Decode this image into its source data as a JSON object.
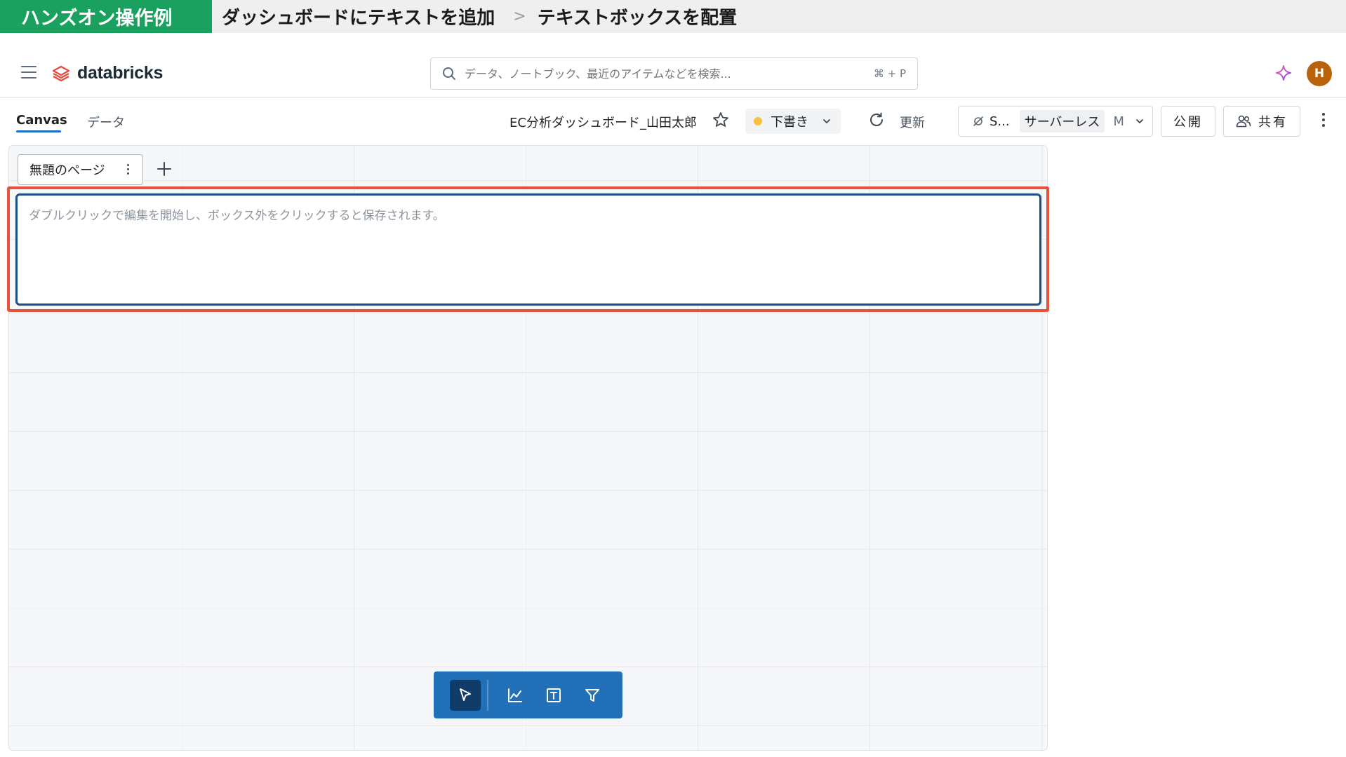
{
  "banner": {
    "tag": "ハンズオン操作例",
    "step": "ダッシュボードにテキストを追加",
    "separator": ">",
    "substep": "テキストボックスを配置"
  },
  "topnav": {
    "logo_text": "databricks",
    "search_placeholder": "データ、ノートブック、最近のアイテムなどを検索...",
    "search_shortcut": "⌘ + P",
    "avatar_initial": "H",
    "icons": [
      "menu-icon",
      "databricks-logo-icon",
      "search-icon",
      "assistant-sparkle-icon"
    ]
  },
  "dashboard": {
    "tabs": [
      {
        "label": "Canvas",
        "active": true
      },
      {
        "label": "データ",
        "active": false
      }
    ],
    "title": "EC分析ダッシュボード_山田太郎",
    "status_label": "下書き",
    "status_color": "#f6c244",
    "refresh_label": "更新",
    "warehouse": {
      "name": "S...",
      "type": "サーバーレス",
      "size": "M"
    },
    "publish_label": "公開",
    "share_label": "共有"
  },
  "canvas": {
    "page_tab_label": "無題のページ",
    "textbox_placeholder": "ダブルクリックで編集を開始し、ボックス外をクリックすると保存されます。",
    "highlight_color": "#e5533d"
  },
  "toolbar": {
    "tools": [
      {
        "name": "select-pointer-icon",
        "active": true
      },
      {
        "name": "visualization-icon",
        "active": false
      },
      {
        "name": "text-box-icon",
        "active": false
      },
      {
        "name": "filter-icon",
        "active": false
      }
    ],
    "accent_color": "#2270b8"
  }
}
